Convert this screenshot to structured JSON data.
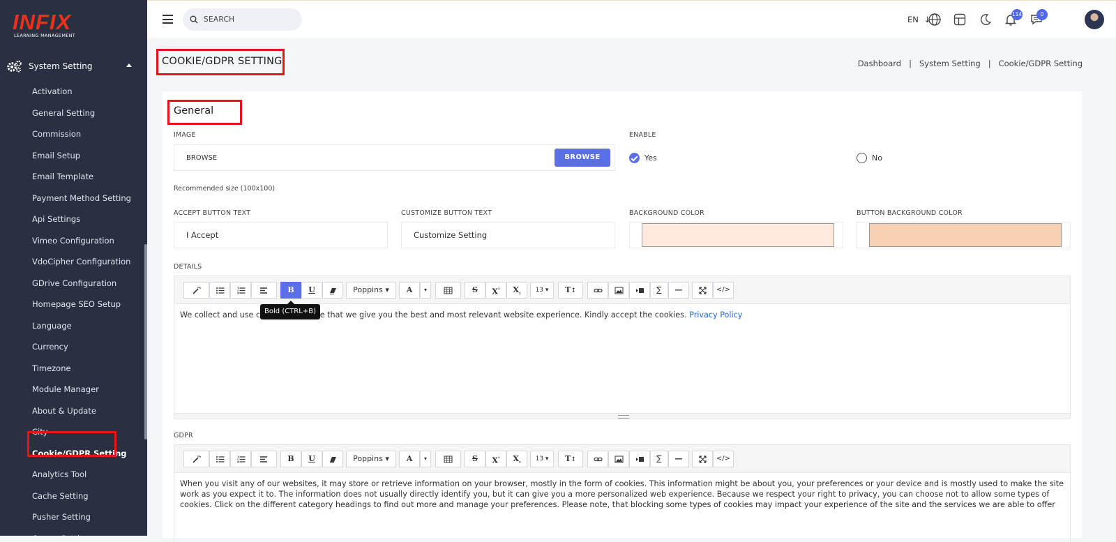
{
  "brand": {
    "name": "INFIX",
    "tagline": "LEARNING MANAGEMENT",
    "accent": "#e8321c"
  },
  "sidebar": {
    "parent_label": "System Setting",
    "items": [
      {
        "label": "Activation"
      },
      {
        "label": "General Setting"
      },
      {
        "label": "Commission"
      },
      {
        "label": "Email Setup"
      },
      {
        "label": "Email Template"
      },
      {
        "label": "Payment Method Setting"
      },
      {
        "label": "Api Settings"
      },
      {
        "label": "Vimeo Configuration"
      },
      {
        "label": "VdoCipher Configuration"
      },
      {
        "label": "GDrive Configuration"
      },
      {
        "label": "Homepage SEO Setup"
      },
      {
        "label": "Language"
      },
      {
        "label": "Currency"
      },
      {
        "label": "Timezone"
      },
      {
        "label": "Module Manager"
      },
      {
        "label": "About & Update"
      },
      {
        "label": "City"
      },
      {
        "label": "Cookie/GDPR Setting",
        "active": true
      },
      {
        "label": "Analytics Tool"
      },
      {
        "label": "Cache Setting"
      },
      {
        "label": "Pusher Setting"
      },
      {
        "label": "Queue Settings"
      }
    ]
  },
  "topbar": {
    "search_placeholder": "SEARCH",
    "language": "EN",
    "notifications_count": "114",
    "messages_count": "0"
  },
  "page": {
    "title": "COOKIE/GDPR SETTING",
    "breadcrumb": [
      "Dashboard",
      "System Setting",
      "Cookie/GDPR Setting"
    ]
  },
  "form": {
    "section_title": "General",
    "image_label": "IMAGE",
    "image_value": "BROWSE",
    "browse_button": "BROWSE",
    "recommended": "Recommended size (100x100)",
    "enable_label": "ENABLE",
    "enable_yes": "Yes",
    "enable_no": "No",
    "enable_selected": "Yes",
    "accept_label": "ACCEPT BUTTON TEXT",
    "accept_value": "I Accept",
    "customize_label": "CUSTOMIZE BUTTON TEXT",
    "customize_value": "Customize Setting",
    "bg_color_label": "BACKGROUND COLOR",
    "bg_color": "#ffeadd",
    "btn_bg_color_label": "BUTTON BACKGROUND COLOR",
    "btn_bg_color": "#f7d0b6",
    "details_label": "DETAILS",
    "details_text": "We collect and use cookies to ensure that we give you the best and most relevant website experience. Kindly accept the cookies.",
    "details_link": "Privacy Policy",
    "gdpr_label": "GDPR",
    "gdpr_text": "When you visit any of our websites, it may store or retrieve information on your browser, mostly in the form of cookies. This information might be about you, your preferences or your device and is mostly used to make the site work as you expect it to. The information does not usually directly identify you, but it can give you a more personalized web experience. Because we respect your right to privacy, you can choose not to allow some types of cookies. Click on the different category headings to find out more and manage your preferences. Please note, that blocking some types of cookies may impact your experience of the site and the services we are able to offer"
  },
  "editor_toolbar": {
    "font": "Poppins",
    "font_size": "13",
    "tooltip": "Bold (CTRL+B)",
    "bold": "B",
    "underline": "U",
    "text_color": "A",
    "strike": "S",
    "sup": "X",
    "sub": "X",
    "sigma": "∑",
    "code": "</>"
  }
}
